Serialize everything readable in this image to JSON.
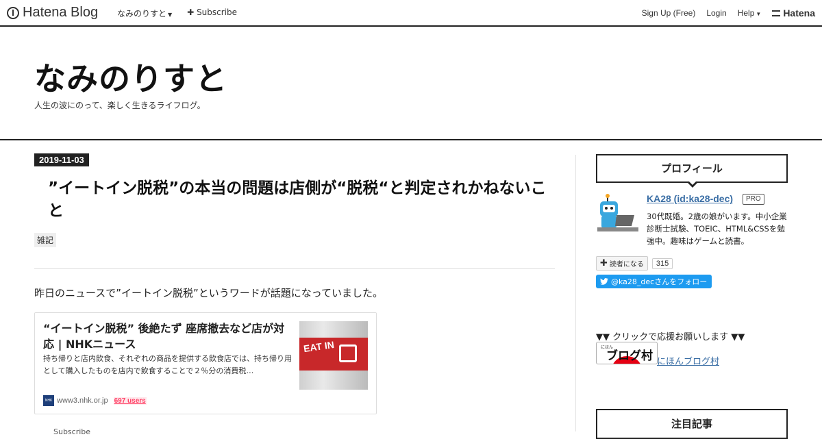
{
  "global_header": {
    "logo": "Hatena Blog",
    "blog_menu": "なみのりすと",
    "subscribe": "Subscribe",
    "signup": "Sign Up (Free)",
    "login": "Login",
    "help": "Help",
    "hatena": "Hatena"
  },
  "blog": {
    "title": "なみのりすと",
    "description": "人生の波にのって、楽しく生きるライフログ。"
  },
  "entry": {
    "date": "2019-11-03",
    "title": "”イートイン脱税”の本当の問題は店側が“脱税“と判定されかねないこと",
    "category": "雑記",
    "intro": "昨日のニュースで”イートイン脱税”というワードが話題になっていました。",
    "share_text": "Subscribe"
  },
  "embed_card": {
    "title": "“イートイン脱税” 後絶たず 座席撤去など店が対応 | NHKニュース",
    "description": "持ち帰りと店内飲食、それぞれの商品を提供する飲食店では、持ち帰り用として購入したものを店内で飲食することで２％分の消費税…",
    "domain": "www3.nhk.or.jp",
    "users": "697 users",
    "favicon_text": "NHK",
    "thumb_text": "EAT IN"
  },
  "sidebar": {
    "profile_heading": "プロフィール",
    "name": "KA28 (id:ka28-dec)",
    "pro_badge": "PRO",
    "bio": "30代既婚。2歳の娘がいます。中小企業診断士試験、TOEIC、HTML&CSSを勉強中。趣味はゲームと読書。",
    "reader_button": "読者になる",
    "reader_count": "315",
    "twitter_follow": "@ka28_decさんをフォロー",
    "support_text": "▼▼ クリックで応援お願いします ▼▼",
    "nihon_badge_small": "にほん",
    "nihon_badge_big": "ブログ村",
    "nihon_link": "にほんブログ村",
    "featured_heading": "注目記事"
  },
  "colors": {
    "link": "#3a6ea5",
    "twitter": "#1d9bf0",
    "hatebu_users": "#ff4166",
    "border_dark": "#222222"
  }
}
